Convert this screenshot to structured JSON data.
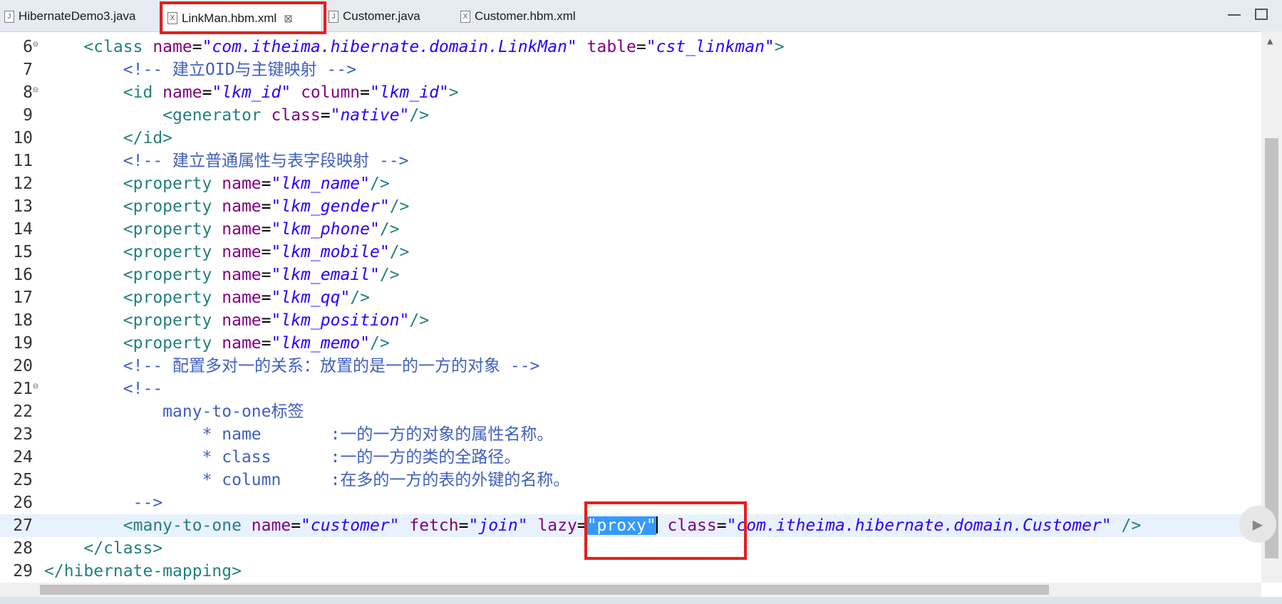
{
  "tabs": [
    {
      "label": "HibernateDemo3.java",
      "icon": "java-file-icon"
    },
    {
      "label": "LinkMan.hbm.xml",
      "icon": "xml-file-icon",
      "active": true
    },
    {
      "label": "Customer.java",
      "icon": "java-file-icon"
    },
    {
      "label": "Customer.hbm.xml",
      "icon": "xml-file-icon"
    }
  ],
  "lines": [
    {
      "n": "6",
      "fold": true,
      "indent": "    ",
      "segs": [
        [
          "t",
          "<class "
        ],
        [
          "a",
          "name"
        ],
        [
          "p",
          "="
        ],
        [
          "v",
          "\"com.itheima.hibernate.domain.LinkMan\""
        ],
        [
          "p",
          " "
        ],
        [
          "a",
          "table"
        ],
        [
          "p",
          "="
        ],
        [
          "v",
          "\"cst_linkman\""
        ],
        [
          "t",
          ">"
        ]
      ]
    },
    {
      "n": "7",
      "indent": "        ",
      "segs": [
        [
          "c",
          "<!-- 建立OID与主键映射 -->"
        ]
      ]
    },
    {
      "n": "8",
      "fold": true,
      "indent": "        ",
      "segs": [
        [
          "t",
          "<id "
        ],
        [
          "a",
          "name"
        ],
        [
          "p",
          "="
        ],
        [
          "v",
          "\"lkm_id\""
        ],
        [
          "p",
          " "
        ],
        [
          "a",
          "column"
        ],
        [
          "p",
          "="
        ],
        [
          "v",
          "\"lkm_id\""
        ],
        [
          "t",
          ">"
        ]
      ]
    },
    {
      "n": "9",
      "indent": "            ",
      "segs": [
        [
          "t",
          "<generator "
        ],
        [
          "a",
          "class"
        ],
        [
          "p",
          "="
        ],
        [
          "v",
          "\"native\""
        ],
        [
          "t",
          "/>"
        ]
      ]
    },
    {
      "n": "10",
      "indent": "        ",
      "segs": [
        [
          "t",
          "</id>"
        ]
      ]
    },
    {
      "n": "11",
      "indent": "        ",
      "segs": [
        [
          "c",
          "<!-- 建立普通属性与表字段映射 -->"
        ]
      ]
    },
    {
      "n": "12",
      "indent": "        ",
      "segs": [
        [
          "t",
          "<property "
        ],
        [
          "a",
          "name"
        ],
        [
          "p",
          "="
        ],
        [
          "v",
          "\"lkm_name\""
        ],
        [
          "t",
          "/>"
        ]
      ]
    },
    {
      "n": "13",
      "indent": "        ",
      "segs": [
        [
          "t",
          "<property "
        ],
        [
          "a",
          "name"
        ],
        [
          "p",
          "="
        ],
        [
          "v",
          "\"lkm_gender\""
        ],
        [
          "t",
          "/>"
        ]
      ]
    },
    {
      "n": "14",
      "indent": "        ",
      "segs": [
        [
          "t",
          "<property "
        ],
        [
          "a",
          "name"
        ],
        [
          "p",
          "="
        ],
        [
          "v",
          "\"lkm_phone\""
        ],
        [
          "t",
          "/>"
        ]
      ]
    },
    {
      "n": "15",
      "indent": "        ",
      "segs": [
        [
          "t",
          "<property "
        ],
        [
          "a",
          "name"
        ],
        [
          "p",
          "="
        ],
        [
          "v",
          "\"lkm_mobile\""
        ],
        [
          "t",
          "/>"
        ]
      ]
    },
    {
      "n": "16",
      "indent": "        ",
      "segs": [
        [
          "t",
          "<property "
        ],
        [
          "a",
          "name"
        ],
        [
          "p",
          "="
        ],
        [
          "v",
          "\"lkm_email\""
        ],
        [
          "t",
          "/>"
        ]
      ]
    },
    {
      "n": "17",
      "indent": "        ",
      "segs": [
        [
          "t",
          "<property "
        ],
        [
          "a",
          "name"
        ],
        [
          "p",
          "="
        ],
        [
          "v",
          "\"lkm_qq\""
        ],
        [
          "t",
          "/>"
        ]
      ]
    },
    {
      "n": "18",
      "indent": "        ",
      "segs": [
        [
          "t",
          "<property "
        ],
        [
          "a",
          "name"
        ],
        [
          "p",
          "="
        ],
        [
          "v",
          "\"lkm_position\""
        ],
        [
          "t",
          "/>"
        ]
      ]
    },
    {
      "n": "19",
      "indent": "        ",
      "segs": [
        [
          "t",
          "<property "
        ],
        [
          "a",
          "name"
        ],
        [
          "p",
          "="
        ],
        [
          "v",
          "\"lkm_memo\""
        ],
        [
          "t",
          "/>"
        ]
      ]
    },
    {
      "n": "20",
      "indent": "        ",
      "segs": [
        [
          "c",
          "<!-- 配置多对一的关系：放置的是一的一方的对象 -->"
        ]
      ]
    },
    {
      "n": "21",
      "fold": true,
      "indent": "        ",
      "segs": [
        [
          "c",
          "<!--"
        ]
      ]
    },
    {
      "n": "22",
      "indent": "            ",
      "segs": [
        [
          "c",
          "many-to-one标签"
        ]
      ]
    },
    {
      "n": "23",
      "indent": "                ",
      "segs": [
        [
          "c",
          "* name       :一的一方的对象的属性名称。"
        ]
      ]
    },
    {
      "n": "24",
      "indent": "                ",
      "segs": [
        [
          "c",
          "* class      :一的一方的类的全路径。"
        ]
      ]
    },
    {
      "n": "25",
      "indent": "                ",
      "segs": [
        [
          "c",
          "* column     :在多的一方的表的外键的名称。"
        ]
      ]
    },
    {
      "n": "26",
      "indent": "         ",
      "segs": [
        [
          "c",
          "-->"
        ]
      ]
    },
    {
      "n": "27",
      "current": true,
      "indent": "        ",
      "segs": [
        [
          "t",
          "<many-to-one "
        ],
        [
          "a",
          "name"
        ],
        [
          "p",
          "="
        ],
        [
          "v",
          "\"customer\""
        ],
        [
          "p",
          " "
        ],
        [
          "a",
          "fetch"
        ],
        [
          "p",
          "="
        ],
        [
          "v",
          "\"join\""
        ],
        [
          "p",
          " "
        ],
        [
          "a",
          "lazy"
        ],
        [
          "p",
          "="
        ],
        [
          "sel",
          "\"proxy\""
        ],
        [
          "cursor",
          ""
        ],
        [
          "p",
          " "
        ],
        [
          "a",
          "class"
        ],
        [
          "p",
          "="
        ],
        [
          "v",
          "\"com.itheima.hibernate.domain.Customer\""
        ],
        [
          "p",
          " "
        ],
        [
          "t",
          "/>"
        ]
      ]
    },
    {
      "n": "28",
      "indent": "    ",
      "segs": [
        [
          "t",
          "</class>"
        ]
      ]
    },
    {
      "n": "29",
      "indent": "",
      "segs": [
        [
          "t",
          "</hibernate-mapping>"
        ]
      ]
    }
  ]
}
